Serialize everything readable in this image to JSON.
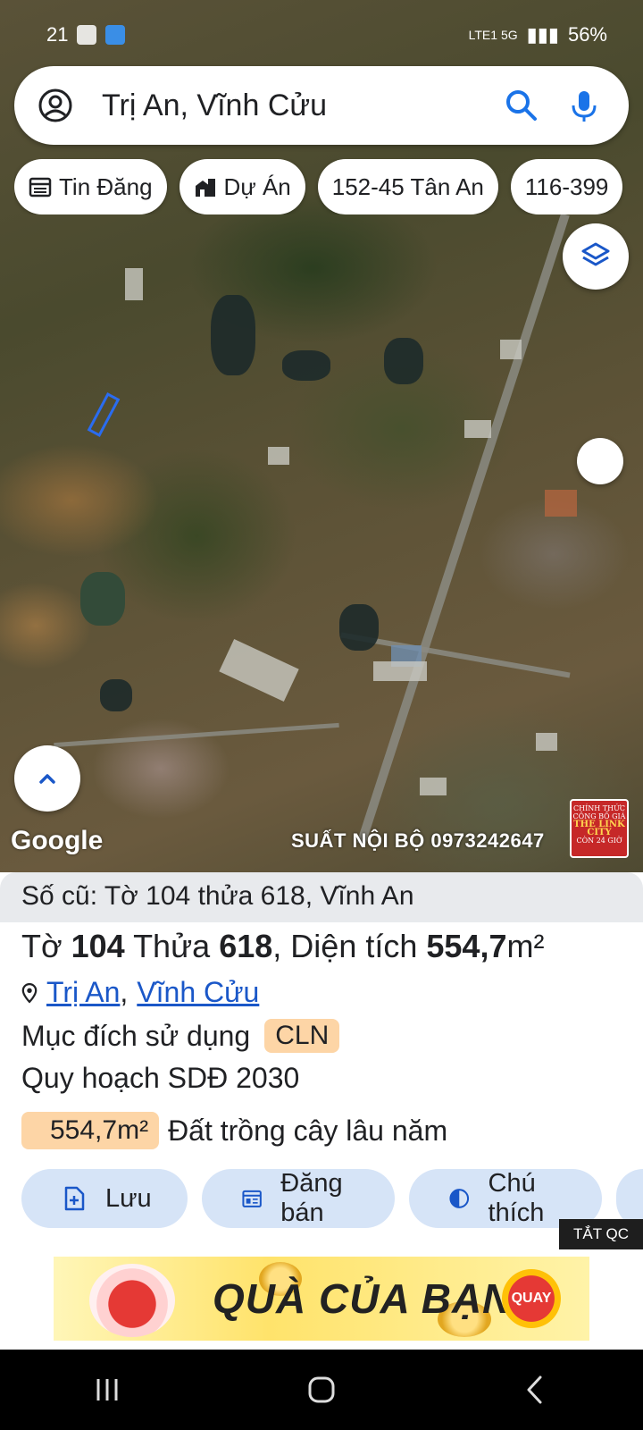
{
  "status_bar": {
    "time": "21",
    "battery": "56%",
    "network": "LTE1 5G"
  },
  "search": {
    "query": "Trị An, Vĩnh Cửu",
    "icons": [
      "account-circle-icon",
      "search-icon",
      "mic-icon"
    ]
  },
  "chips": [
    {
      "label": "Tin Đăng",
      "icon": "calendar-icon"
    },
    {
      "label": "Dự Án",
      "icon": "buildings-icon"
    },
    {
      "label": "152-45 Tân An",
      "icon": ""
    },
    {
      "label": "116-399",
      "icon": ""
    }
  ],
  "map": {
    "logo": "Google",
    "watermark": "SUẤT NỘI BỘ 0973242647",
    "stamp": {
      "lines": [
        "CHÍNH THỨC",
        "CÔNG BỐ GIÁ",
        "THE LINK",
        "CITY",
        "CÒN 24 GIỜ"
      ]
    }
  },
  "parcel": {
    "old_ref": "Số cũ: Tờ 104 thửa 618, Vĩnh An",
    "title": {
      "to_label": "Tờ",
      "to": "104",
      "thua_label": "Thửa",
      "thua": "618",
      "area_label": ", Diện tích",
      "area": "554,7",
      "unit": "m²"
    },
    "location": {
      "commune": "Trị An",
      "district": "Vĩnh Cửu"
    },
    "purpose_label": "Mục đích sử dụng",
    "purpose_code": "CLN",
    "plan": "Quy hoạch SDĐ 2030",
    "area_badge": "554,7m²",
    "land_type": "Đất trồng cây lâu năm"
  },
  "actions": [
    {
      "label": "Lưu",
      "icon": "save-icon"
    },
    {
      "label": "Đăng bán",
      "icon": "listing-icon"
    },
    {
      "label": "Chú thích",
      "icon": "contrast-icon"
    }
  ],
  "ad": {
    "off_label": "TẮT QC",
    "banner_text": "QUÀ CỦA BẠN",
    "button": "QUAY"
  },
  "colors": {
    "link": "#1a57c8",
    "badge": "#fdd5a6",
    "action_bg": "#d6e4f7",
    "plot_outline": "#2a6cf0"
  }
}
